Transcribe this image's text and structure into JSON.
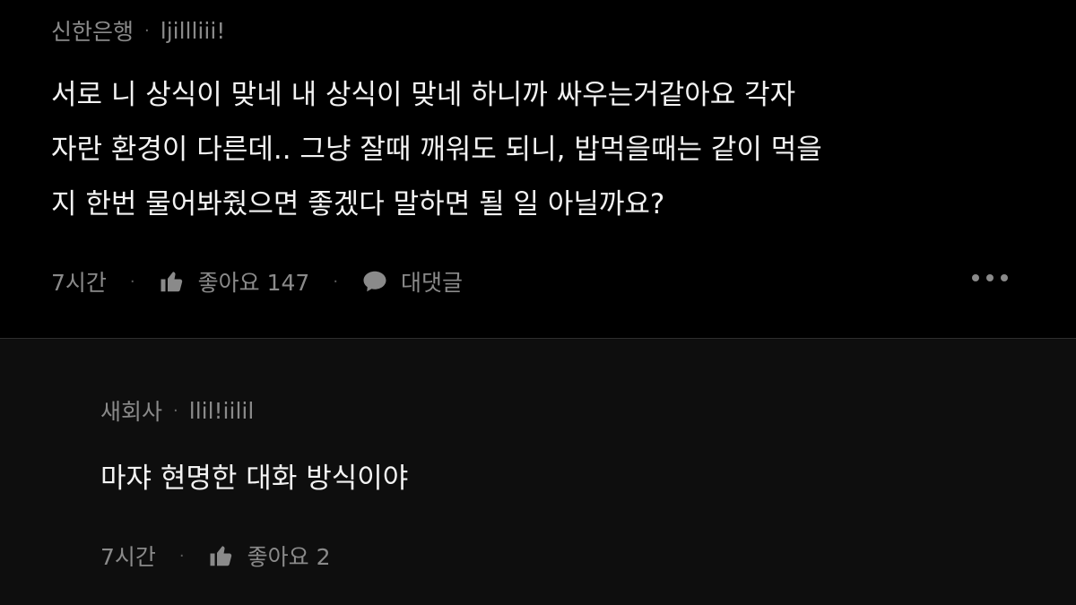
{
  "comments": [
    {
      "company": "신한은행",
      "separator": "·",
      "nickname": "ljillliii!",
      "text": "서로 니 상식이 맞네 내 상식이 맞네 하니까 싸우는거같아요 각자\n자란 환경이 다른데.. 그냥 잘때 깨워도 되니, 밥먹을때는 같이 먹을\n지 한번 물어봐줬으면 좋겠다 말하면 될 일 아닐까요?",
      "time": "7시간",
      "like_label": "좋아요 147",
      "reply_label": "대댓글",
      "dot_sep": "·"
    },
    {
      "company": "새회사",
      "separator": "·",
      "nickname": "llil!iilil",
      "text": "마쟈 현명한 대화 방식이야",
      "time": "7시간",
      "like_label": "좋아요 2",
      "dot_sep": "·"
    }
  ],
  "icons": {
    "like": "thumbs-up-icon",
    "reply": "speech-bubble-icon",
    "more": "more-horizontal-icon"
  },
  "colors": {
    "background": "#000000",
    "reply_background": "#0e0e0e",
    "text": "#f3f3f3",
    "muted": "#8a8a8a"
  }
}
